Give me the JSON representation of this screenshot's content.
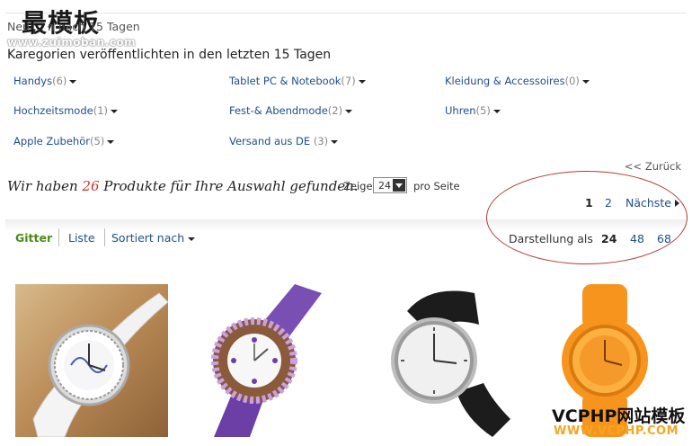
{
  "watermark_top": "最模板",
  "watermark_top_url": "www.zuimoban.com",
  "breadcrumb": "Neu ... n nach 15 Tagen",
  "category_title": "Karegorien veröffentlichten in den letzten 15 Tagen",
  "categories": [
    {
      "label": "Handys",
      "count": "(6)"
    },
    {
      "label": "Tablet PC & Notebook",
      "count": "(7)"
    },
    {
      "label": "Kleidung & Accessoires",
      "count": "(0)"
    },
    {
      "label": "Hochzeitsmode",
      "count": "(1)"
    },
    {
      "label": "Fest-& Abendmode",
      "count": "(2)"
    },
    {
      "label": "Uhren",
      "count": "(5)"
    },
    {
      "label": "Apple Zubehör",
      "count": "(5)"
    },
    {
      "label": "Versand aus DE",
      "count": "(3)"
    }
  ],
  "back_link": "<< Zurück",
  "found": {
    "prefix": "Wir haben ",
    "count": "26",
    "suffix": " Produkte für Ihre Auswahl gefunden."
  },
  "per_page": {
    "label": "Zeige",
    "value": "24",
    "suffix": "pro Seite"
  },
  "pagination": {
    "current": "1",
    "page2": "2",
    "next": "Nächste"
  },
  "toolbar": {
    "grid": "Gitter",
    "list": "Liste",
    "sort": "Sortiert nach"
  },
  "display": {
    "label": "Darstellung als",
    "options": [
      "24",
      "48",
      "68"
    ]
  },
  "products": [
    {
      "icon": "white-crystal-watch",
      "color": "#c9a873"
    },
    {
      "icon": "purple-crystal-watch",
      "color": "#7a4fb3"
    },
    {
      "icon": "black-silver-watch",
      "color": "#222222"
    },
    {
      "icon": "orange-silicone-watch",
      "color": "#f7941d"
    }
  ],
  "watermark_bottom": "VCPHP网站模板",
  "watermark_bottom_url": "WWW.VCPHP.COM"
}
